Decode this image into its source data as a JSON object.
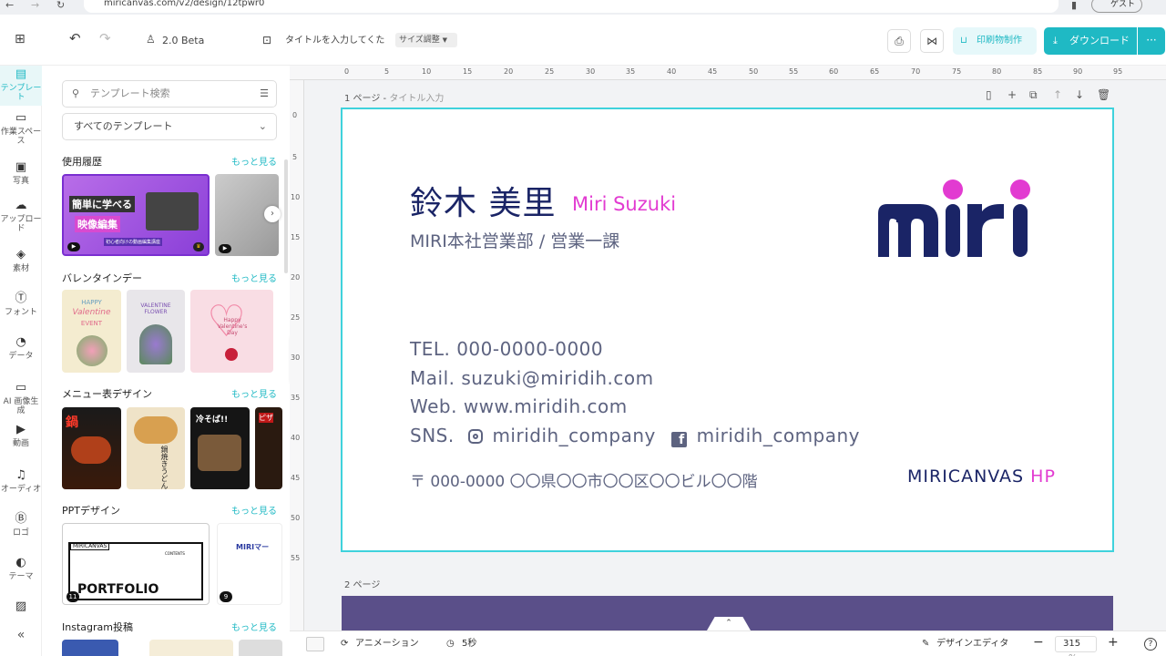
{
  "browser": {
    "url": "miricanvas.com/v2/design/12tpwr0",
    "profile_label": "ゲスト"
  },
  "topbar": {
    "version_label": "2.0 Beta",
    "title_placeholder": "タイトルを入力してくた",
    "size_button": "サイズ調整",
    "print_button": "印刷物制作",
    "download_button": "ダウンロード"
  },
  "rail": {
    "items": [
      {
        "label": "テンプレート",
        "icon": "template-icon",
        "active": true
      },
      {
        "label": "作業スペース",
        "icon": "workspace-icon"
      },
      {
        "label": "写真",
        "icon": "photo-icon"
      },
      {
        "label": "アップロード",
        "icon": "upload-icon"
      },
      {
        "label": "素材",
        "icon": "elements-icon"
      },
      {
        "label": "フォント",
        "icon": "text-icon"
      },
      {
        "label": "データ",
        "icon": "chart-icon"
      },
      {
        "label": "AI 画像生成",
        "icon": "ai-image-icon"
      },
      {
        "label": "動画",
        "icon": "video-icon"
      },
      {
        "label": "オーディオ",
        "icon": "audio-icon"
      },
      {
        "label": "ロゴ",
        "icon": "logo-icon"
      },
      {
        "label": "テーマ",
        "icon": "theme-icon"
      },
      {
        "label": "",
        "icon": "pattern-icon"
      }
    ]
  },
  "panel": {
    "search_placeholder": "テンプレート検索",
    "filter_label": "すべてのテンプレート",
    "more_label": "もっと見る",
    "sections": [
      {
        "title": "使用履歴"
      },
      {
        "title": "バレンタインデー"
      },
      {
        "title": "メニュー表デザイン"
      },
      {
        "title": "PPTデザイン"
      },
      {
        "title": "Instagram投稿"
      }
    ],
    "recent_thumb": {
      "line1": "簡単に学べる",
      "line2": "映像編集",
      "caption": "初心者向けの動画編集講座"
    },
    "valentine": {
      "t1": "HAPPY",
      "t2": "Valentine",
      "t3": "EVENT",
      "t4": "VALENTINE FLOWER",
      "t5": "Happy Valentine's Day"
    },
    "menu": {
      "t1": "鍋",
      "t2": "鍋焼きうどん",
      "t3": "冷そば!!",
      "t4": "ピザ"
    },
    "ppt": {
      "brand": "MIRICANVAS",
      "contents": "CONTENTS",
      "big": "PORTFOLIO",
      "badge1": "11",
      "brand2": "MIRIマー",
      "badge2": "9"
    }
  },
  "canvas": {
    "page1_label": "1 ページ -",
    "page1_title_placeholder": "タイトル入力",
    "page2_label": "2 ページ",
    "ruler_top": [
      "0",
      "5",
      "10",
      "15",
      "20",
      "25",
      "30",
      "35",
      "40",
      "45",
      "50",
      "55",
      "60",
      "65",
      "70",
      "75",
      "80",
      "85",
      "90",
      "95"
    ],
    "ruler_left": [
      "0",
      "5",
      "10",
      "15",
      "20",
      "25",
      "30",
      "35",
      "40",
      "45",
      "50",
      "55"
    ]
  },
  "card": {
    "name_jp": "鈴木 美里",
    "name_en": "Miri Suzuki",
    "department": "MIRI本社営業部 / 営業一課",
    "tel": "TEL.  000-0000-0000",
    "mail": "Mail. suzuki@miridih.com",
    "web": "Web. www.miridih.com",
    "sns_label": "SNS.",
    "sns_instagram": "miridih_company",
    "sns_facebook": "miridih_company",
    "address": "〒 000-0000 〇〇県〇〇市〇〇区〇〇ビル〇〇階",
    "hp_label_main": "MIRICANVAS",
    "hp_label_accent": "HP",
    "logo_text": "miri",
    "colors": {
      "navy": "#1a2466",
      "magenta": "#e23bd1",
      "gray": "#5d6380",
      "frame": "#3fd2dc"
    }
  },
  "bottombar": {
    "animation_label": "アニメーション",
    "duration_label": "5秒",
    "design_editor_label": "デザインエディタ",
    "zoom_value": "315",
    "zoom_unit": "%"
  }
}
